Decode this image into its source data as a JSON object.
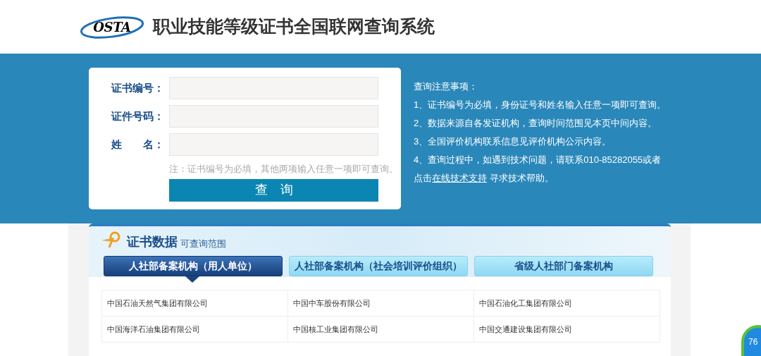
{
  "header": {
    "logo": "OSTA",
    "title": "职业技能等级证书全国联网查询系统"
  },
  "form": {
    "fields": [
      {
        "label": "证书编号："
      },
      {
        "label": "证件号码："
      },
      {
        "label": "姓　　名："
      }
    ],
    "note": "注：证书编号为必填，其他两项输入任意一项即可查询。",
    "button": "查　询"
  },
  "notice": {
    "title": "查询注意事项：",
    "lines": [
      "1、证书编号为必填，身份证号和姓名输入任意一项即可查询。",
      "2、数据来源自各发证机构，查询时间范围见本页中间内容。",
      "3、全国评价机构联系信息见评价机构公示内容。",
      "4、查询过程中，如遇到技术问题，请联系010-85282055或者"
    ],
    "last_prefix": "点击",
    "link": "在线技术支持",
    "last_suffix": " 寻求技术帮助。"
  },
  "data_section": {
    "title": "证书数据",
    "subtitle": "可查询范围",
    "tabs": [
      {
        "label": "人社部备案机构（用人单位）",
        "selected": true
      },
      {
        "label": "人社部备案机构（社会培训评价组织）",
        "selected": false
      },
      {
        "label": "省级人社部门备案机构",
        "selected": false
      }
    ],
    "rows": [
      [
        "中国石油天然气集团有限公司",
        "中国中车股份有限公司",
        "中国石油化工集团有限公司"
      ],
      [
        "中国海洋石油集团有限公司",
        "中国核工业集团有限公司",
        "中国交通建设集团有限公司"
      ]
    ]
  },
  "speed_ball": "76"
}
